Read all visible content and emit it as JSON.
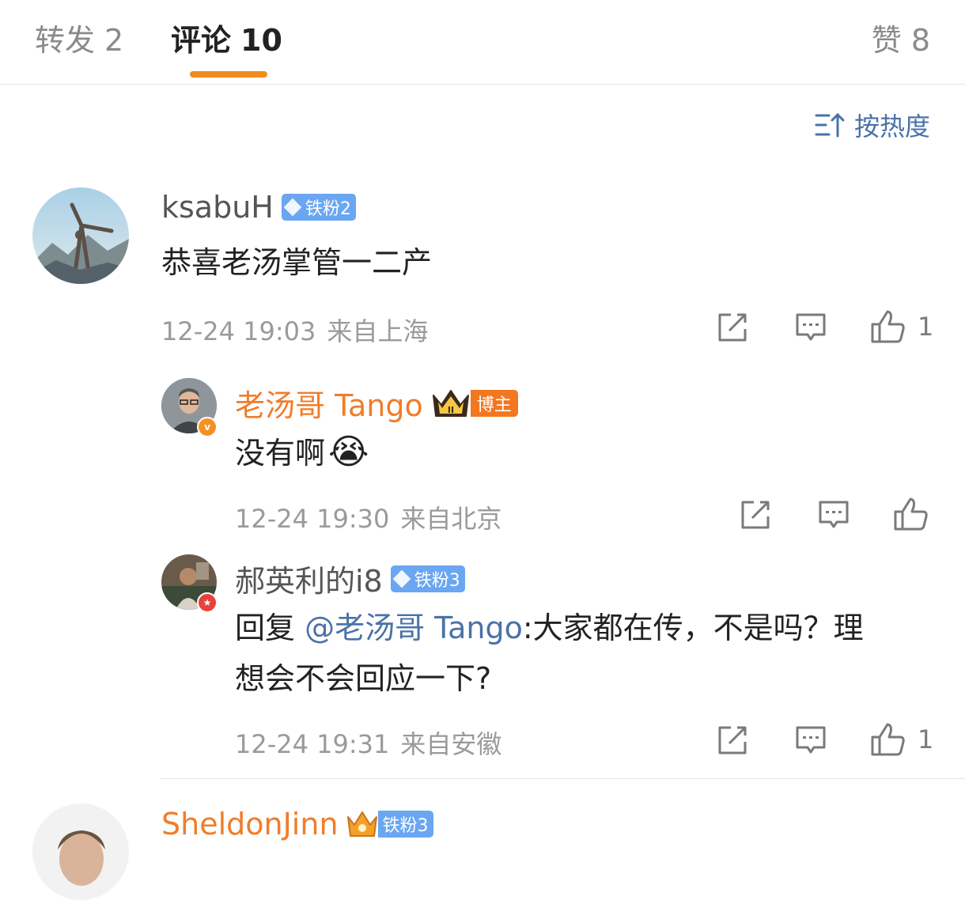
{
  "tabs": [
    {
      "label": "转发",
      "count": "2"
    },
    {
      "label": "评论",
      "count": "10"
    },
    {
      "label": "赞",
      "count": "8"
    }
  ],
  "sort": {
    "label": "按热度",
    "icon": "sort-icon"
  },
  "comments": [
    {
      "user": "ksabuH",
      "badge": "铁粉2",
      "text": "恭喜老汤掌管一二产",
      "time": "12-24 19:03",
      "location": "来自上海",
      "like_count": "1"
    },
    {
      "user": "老汤哥 Tango",
      "badge": "博主",
      "text": "没有啊",
      "emoji": "😭",
      "time": "12-24 19:30",
      "location": "来自北京",
      "like_count": ""
    },
    {
      "user": "郝英利的i8",
      "badge": "铁粉3",
      "reply_prefix": "回复 ",
      "mention": "@老汤哥 Tango",
      "text_line1": ":大家都在传，不是吗？理",
      "text_line2": "想会不会回应一下?",
      "time": "12-24 19:31",
      "location": "来自安徽",
      "like_count": "1"
    },
    {
      "user": "SheldonJinn",
      "badge": "铁粉3"
    }
  ],
  "colors": {
    "accent": "#f28b1d",
    "link": "#4a72a8",
    "badge_blue": "#6aa6f2",
    "badge_orange": "#f3771f"
  }
}
